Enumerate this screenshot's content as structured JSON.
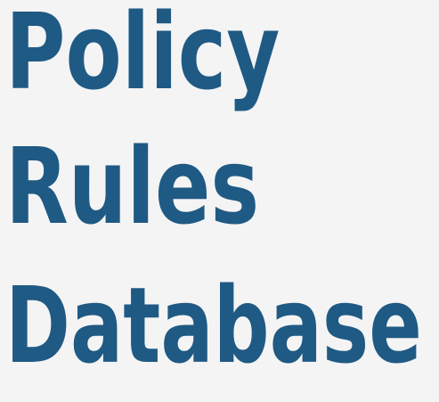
{
  "title": {
    "lines": [
      "Policy",
      "Rules",
      "Database"
    ]
  },
  "colors": {
    "background": "#f4f4f4",
    "text": "#1f5a84"
  }
}
